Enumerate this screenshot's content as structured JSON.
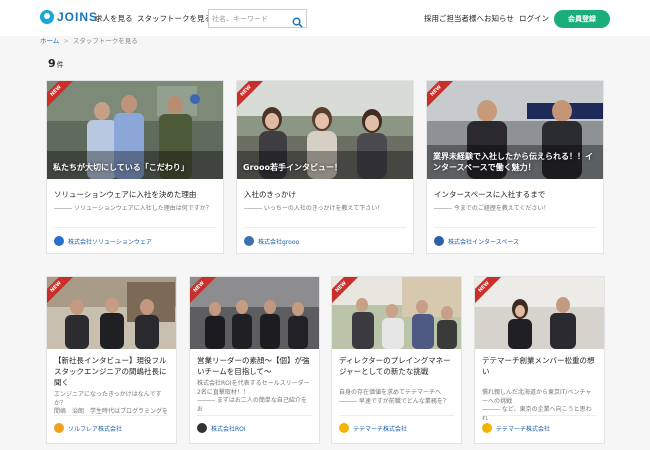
{
  "header": {
    "logo": "JOINS",
    "nav": [
      "求人を見る",
      "スタッフトークを見る"
    ],
    "search_placeholder": "社名、キーワード",
    "right_nav": [
      "採用ご担当者様へ",
      "お知らせ",
      "ログイン"
    ],
    "register": "会員登録"
  },
  "breadcrumb": {
    "home": "ホーム",
    "current": "スタッフトークを見る"
  },
  "count": {
    "number": "9",
    "unit": "件"
  },
  "badge": "NEW",
  "cards": [
    {
      "overlay": "私たちが大切にしている「こだわり」",
      "title": "ソリューションウェアに入社を決めた理由",
      "desc": "――― ソリューションウェアに入社した理由は何ですか？",
      "company": "株式会社ソリューションウェア",
      "logo_color": "#2a6fc9"
    },
    {
      "overlay": "Grooo若手インタビュー！",
      "title": "入社のきっかけ",
      "desc": "――― いっちーの入社のきっかけを教えて下さい！",
      "company": "株式会社grooo",
      "logo_color": "#3b6fb0"
    },
    {
      "overlay": "業界未経験で入社したから伝えられる！！インタースペースで働く魅力！",
      "title": "インタースペースに入社するまで",
      "desc": "――― 今までのご経歴を教えてください！",
      "company": "株式会社インタースペース",
      "logo_color": "#2b5fa8"
    },
    {
      "overlay": "",
      "title": "【新社長インタビュー】現役フルスタックエンジニアの間嶋社長に聞く",
      "desc": "エンジニアになったきっかけはなんですか？\n間嶋　治朗　学生時代はプログラミングを",
      "company": "ソルフレア株式会社",
      "logo_color": "#f0a020"
    },
    {
      "overlay": "",
      "title": "営業リーダーの素顔～【個】が強いチームを目指して～",
      "desc": "株式会社ROIを代表するセールスリーダー2名に直撃取材！！\n――― まずはお二人の簡単な自己紹介をお",
      "company": "株式会社ROI",
      "logo_color": "#333333"
    },
    {
      "overlay": "",
      "title": "ディレクターのプレイングマネージャーとしての新たな挑戦",
      "desc": "自身の存在価値を求めてテテマーチへ\n――― 早速ですが前職でどんな業務を？",
      "company": "テテマーチ株式会社",
      "logo_color": "#f2b400"
    },
    {
      "overlay": "",
      "title": "テテマーチ創業メンバー松重の想い",
      "desc": "慣れ親しんだ北海道から東京IT/ベンチャーへの挑戦\n――― など、東京の企業へ向こうと思われ",
      "company": "テテマーチ株式会社",
      "logo_color": "#f2b400"
    }
  ]
}
